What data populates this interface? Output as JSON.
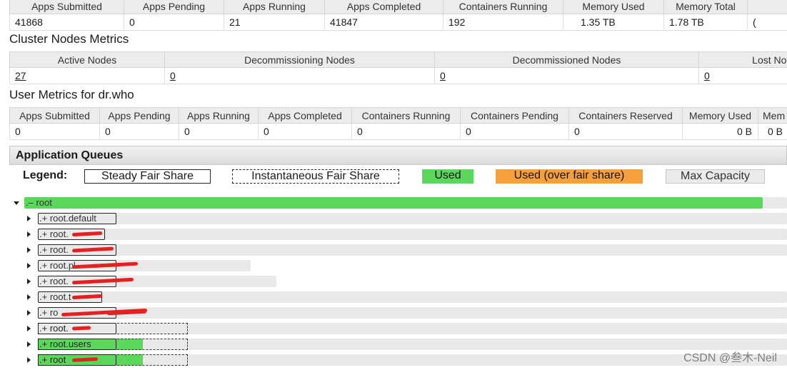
{
  "cluster_metrics": {
    "headers": [
      "Apps Submitted",
      "Apps Pending",
      "Apps Running",
      "Apps Completed",
      "Containers Running",
      "Memory Used",
      "Memory Total",
      ""
    ],
    "values": [
      "41868",
      "0",
      "21",
      "41847",
      "192",
      "1.35 TB",
      "1.78 TB",
      "("
    ]
  },
  "cluster_nodes": {
    "title": "Cluster Nodes Metrics",
    "headers": [
      "Active Nodes",
      "Decommissioning Nodes",
      "Decommissioned Nodes",
      "Lost Node"
    ],
    "values": [
      "27",
      "0",
      "0",
      "0"
    ]
  },
  "user_metrics": {
    "title": "User Metrics for dr.who",
    "headers": [
      "Apps Submitted",
      "Apps Pending",
      "Apps Running",
      "Apps Completed",
      "Containers Running",
      "Containers Pending",
      "Containers Reserved",
      "Memory Used",
      "Mem"
    ],
    "values": [
      "0",
      "0",
      "0",
      "0",
      "0",
      "0",
      "0",
      "0 B",
      "0 B"
    ]
  },
  "queues": {
    "title": "Application Queues",
    "legend": {
      "label": "Legend:",
      "steady": "Steady Fair Share",
      "instantaneous": "Instantaneous Fair Share",
      "used": "Used",
      "over": "Used (over fair share)",
      "max": "Max Capacity"
    },
    "root_label": ".– root",
    "items": [
      {
        "label": ".+ root.default",
        "used": 0,
        "inst": 0
      },
      {
        "label": ".+ root.",
        "used": 0,
        "inst": 0
      },
      {
        "label": ".+ root.",
        "used": 0,
        "inst": 0
      },
      {
        "label": ".+ root.pl",
        "used": 0,
        "inst": 0
      },
      {
        "label": ".+ root.",
        "used": 0,
        "inst": 0
      },
      {
        "label": ".+ root.t",
        "used": 0,
        "inst": 0
      },
      {
        "label": ".+ ro",
        "used": 0,
        "inst": 0
      },
      {
        "label": ".+ root.",
        "used": 0,
        "inst": 0.2
      },
      {
        "label": ".+ root.users",
        "used": 0.14,
        "inst": 0.2
      },
      {
        "label": ".+ root",
        "used": 0.14,
        "inst": 0.2
      }
    ]
  },
  "colors": {
    "used": "#5bd75b",
    "over": "#f5a03c",
    "max": "#eaeaea"
  },
  "watermark": "CSDN @叁木-Neil"
}
